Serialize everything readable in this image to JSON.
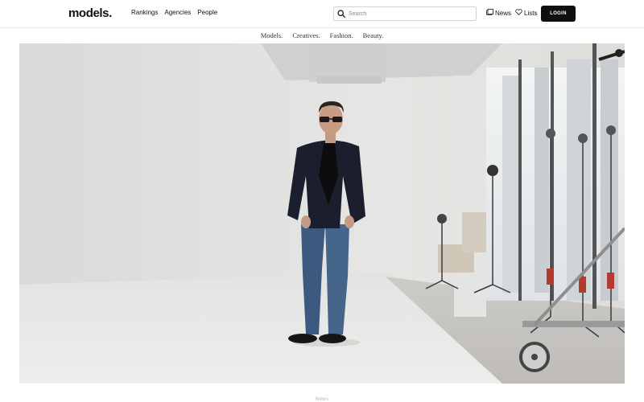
{
  "brand": {
    "logo": "models."
  },
  "main_nav": [
    {
      "label": "Rankings"
    },
    {
      "label": "Agencies"
    },
    {
      "label": "People"
    }
  ],
  "search": {
    "placeholder": "Search",
    "icon": "search-icon"
  },
  "utility_nav": {
    "news": {
      "label": "News",
      "icon": "news-icon"
    },
    "lists": {
      "label": "Lists",
      "icon": "heart-icon"
    },
    "login": {
      "label": "LOGIN"
    }
  },
  "sub_nav": [
    {
      "label": "Models."
    },
    {
      "label": "Creatives."
    },
    {
      "label": "Fashion."
    },
    {
      "label": "Beauty."
    }
  ],
  "hero": {},
  "article": {
    "category": "News"
  },
  "colors": {
    "accent": "#0f0f0f",
    "divider": "#ebebeb",
    "muted": "#b5b5b5"
  }
}
